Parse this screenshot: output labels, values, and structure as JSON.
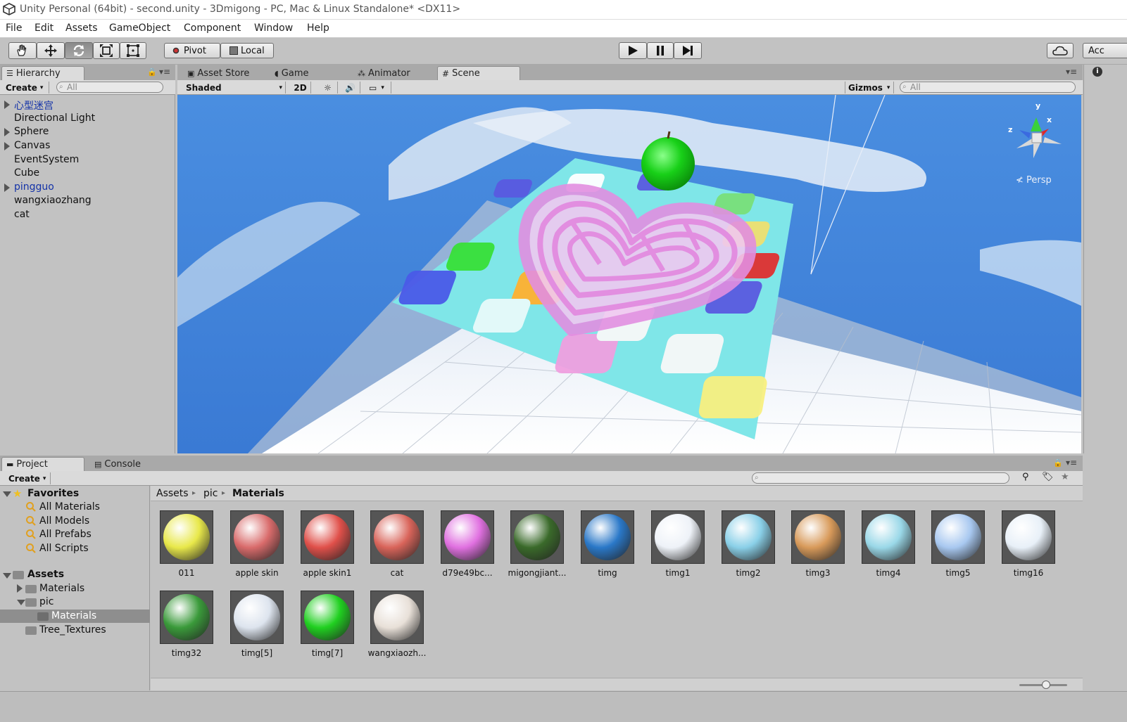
{
  "window": {
    "title": "Unity Personal (64bit) - second.unity - 3Dmigong - PC, Mac & Linux Standalone* <DX11>"
  },
  "menu": [
    "File",
    "Edit",
    "Assets",
    "GameObject",
    "Component",
    "Window",
    "Help"
  ],
  "toolbar": {
    "pivot": "Pivot",
    "local": "Local",
    "account": "Acc"
  },
  "hierarchy": {
    "tab": "Hierarchy",
    "create": "Create",
    "search": "All",
    "items": [
      "心型迷宫",
      "Directional Light",
      "Sphere",
      "Canvas",
      "EventSystem",
      "Cube",
      "pingguo",
      "wangxiaozhang",
      "cat"
    ]
  },
  "scene_tabs": [
    "Asset Store",
    "Game",
    "Animator",
    "Scene"
  ],
  "scene_toolbar": {
    "shading": "Shaded",
    "mode2d": "2D",
    "gizmos": "Gizmos",
    "search": "All"
  },
  "gizmo": {
    "y": "y",
    "x": "x",
    "z": "z",
    "persp": "Persp"
  },
  "project": {
    "tab": "Project",
    "console_tab": "Console",
    "create": "Create",
    "favorites_label": "Favorites",
    "favorites": [
      "All Materials",
      "All Models",
      "All Prefabs",
      "All Scripts"
    ],
    "assets_label": "Assets",
    "tree": [
      "Materials",
      "pic",
      "Materials",
      "Tree_Textures"
    ],
    "breadcrumb": [
      "Assets",
      "pic",
      "Materials"
    ],
    "assets": [
      {
        "name": "011",
        "color": "#e8e84a"
      },
      {
        "name": "apple skin",
        "color": "#d96b6b"
      },
      {
        "name": "apple skin1",
        "color": "#e0504a"
      },
      {
        "name": "cat",
        "color": "#d9645a"
      },
      {
        "name": "d79e49bc...",
        "color": "#e070e0"
      },
      {
        "name": "migongjiant...",
        "color": "#3a6a2a"
      },
      {
        "name": "timg",
        "color": "#2a78c8"
      },
      {
        "name": "timg1",
        "color": "#eef2f8"
      },
      {
        "name": "timg2",
        "color": "#8ad0e8"
      },
      {
        "name": "timg3",
        "color": "#d89a5a"
      },
      {
        "name": "timg4",
        "color": "#9ad8e8"
      },
      {
        "name": "timg5",
        "color": "#a8c8f0"
      },
      {
        "name": "timg16",
        "color": "#e8f0f8"
      },
      {
        "name": "timg32",
        "color": "#3a9a3a"
      },
      {
        "name": "timg[5]",
        "color": "#dde4ee"
      },
      {
        "name": "timg[7]",
        "color": "#20d020"
      },
      {
        "name": "wangxiaozh...",
        "color": "#e8e0d8"
      }
    ]
  }
}
